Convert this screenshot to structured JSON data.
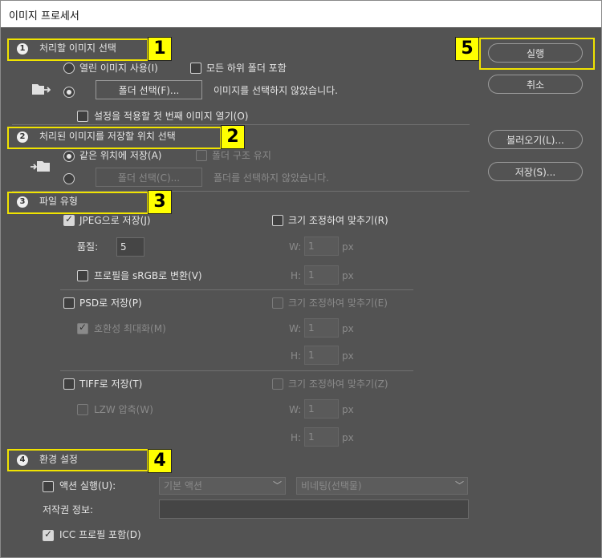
{
  "window": {
    "title": "이미지 프로세서"
  },
  "annotations": [
    "1",
    "2",
    "3",
    "4",
    "5"
  ],
  "section1": {
    "step": "1",
    "title": "처리할 이미지 선택",
    "open_images_label": "열린 이미지 사용(I)",
    "include_subfolders_label": "모든 하위 폴더 포함",
    "select_folder_label": "폴더 선택(F)...",
    "no_images_text": "이미지를 선택하지 않았습니다.",
    "open_first_label": "설정을 적용할 첫 번째 이미지 열기(O)"
  },
  "section2": {
    "step": "2",
    "title": "처리된 이미지를 저장할 위치 선택",
    "same_location_label": "같은 위치에 저장(A)",
    "keep_structure_label": "폴더 구조 유지",
    "select_folder_label": "폴더 선택(C)...",
    "no_folder_text": "폴더를 선택하지 않았습니다."
  },
  "section3": {
    "step": "3",
    "title": "파일 유형",
    "jpeg_label": "JPEG으로 저장(J)",
    "jpeg_checked": true,
    "resize_label_r": "크기 조정하여 맞추기(R)",
    "quality_label": "품질:",
    "quality_value": "5",
    "w_label": "W:",
    "h_label": "H:",
    "unit_label": "px",
    "dim_value": "1",
    "srgb_label": "프로필을 sRGB로 변환(V)",
    "psd_label": "PSD로 저장(P)",
    "resize_label_e": "크기 조정하여 맞추기(E)",
    "maximize_label": "호환성 최대화(M)",
    "tiff_label": "TIFF로 저장(T)",
    "resize_label_z": "크기 조정하여 맞추기(Z)",
    "lzw_label": "LZW 압축(W)"
  },
  "section4": {
    "step": "4",
    "title": "환경 설정",
    "run_action_label": "액션 실행(U):",
    "action_set": "기본 액션",
    "action_name": "비네팅(선택물)",
    "copyright_label": "저작권 정보:",
    "copyright_value": "",
    "icc_label": "ICC 프로필 포함(D)",
    "icc_checked": true
  },
  "buttons": {
    "run": "실행",
    "cancel": "취소",
    "load": "불러오기(L)...",
    "save": "저장(S)..."
  },
  "colors": {
    "dialog_bg": "#535353",
    "highlight": "#ffff00",
    "highlight_border": "#f0e300"
  }
}
